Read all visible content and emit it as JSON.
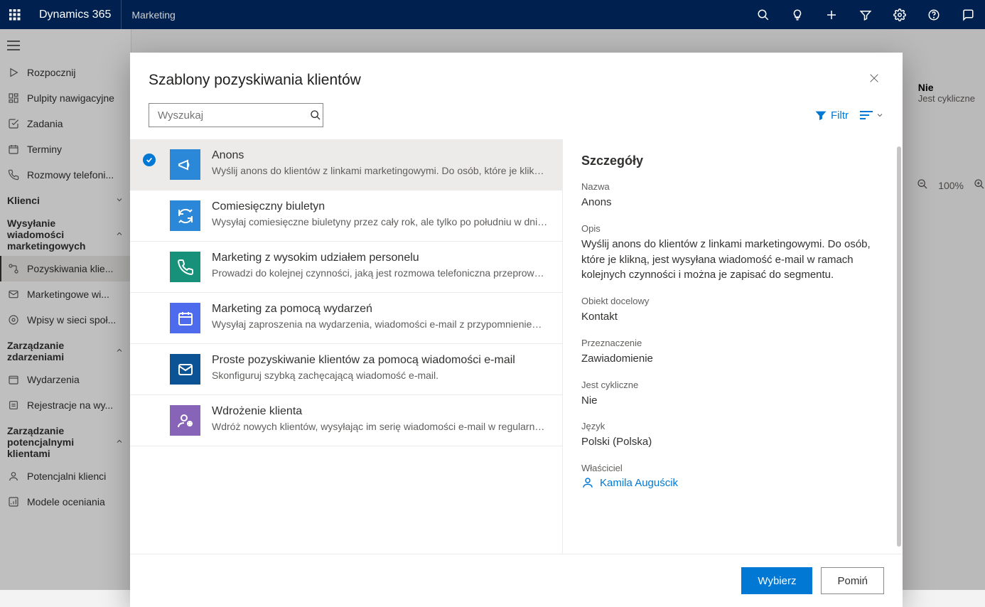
{
  "topbar": {
    "brand": "Dynamics 365",
    "area": "Marketing"
  },
  "nav": {
    "items_top": [
      {
        "label": "Rozpocznij",
        "icon": "play"
      },
      {
        "label": "Pulpity nawigacyjne",
        "icon": "dashboard"
      },
      {
        "label": "Zadania",
        "icon": "task"
      },
      {
        "label": "Terminy",
        "icon": "calendar"
      },
      {
        "label": "Rozmowy telefoni...",
        "icon": "phone"
      }
    ],
    "group_klienci": "Klienci",
    "group_marketing": "Wysyłanie wiadomości marketingowych",
    "marketing_items": [
      {
        "label": "Pozyskiwania klie...",
        "icon": "journey",
        "active": true
      },
      {
        "label": "Marketingowe wi...",
        "icon": "mail"
      },
      {
        "label": "Wpisy w sieci społ...",
        "icon": "social"
      }
    ],
    "group_events": "Zarządzanie zdarzeniami",
    "events_items": [
      {
        "label": "Wydarzenia",
        "icon": "event"
      },
      {
        "label": "Rejestracje na wy...",
        "icon": "register"
      }
    ],
    "group_leads": "Zarządzanie potencjalnymi klientami",
    "leads_items": [
      {
        "label": "Potencjalni klienci",
        "icon": "lead"
      },
      {
        "label": "Modele oceniania",
        "icon": "score"
      }
    ]
  },
  "behind": {
    "chip_label": "Nie",
    "chip_sub": "Jest cykliczne",
    "zoom": "100%"
  },
  "modal": {
    "title": "Szablony pozyskiwania klientów",
    "search_placeholder": "Wyszukaj",
    "filter_label": "Filtr",
    "templates": [
      {
        "title": "Anons",
        "desc": "Wyślij anons do klientów z linkami marketingowymi. Do osób, które je klikną, jest ...",
        "color": "#2b88d8",
        "icon": "megaphone",
        "selected": true
      },
      {
        "title": "Comiesięczny biuletyn",
        "desc": "Wysyłaj comiesięczne biuletyny przez cały rok, ale tylko po południu w dni powsze...",
        "color": "#2b88d8",
        "icon": "refresh"
      },
      {
        "title": "Marketing z wysokim udziałem personelu",
        "desc": "Prowadzi do kolejnej czynności, jaką jest rozmowa telefoniczna przeprowadzana pr...",
        "color": "#17917a",
        "icon": "phone"
      },
      {
        "title": "Marketing za pomocą wydarzeń",
        "desc": "Wysyłaj zaproszenia na wydarzenia, wiadomości e-mail z przypomnieniem, a na ko...",
        "color": "#4f6bed",
        "icon": "calendar"
      },
      {
        "title": "Proste pozyskiwanie klientów za pomocą wiadomości e-mail",
        "desc": "Skonfiguruj szybką zachęcającą wiadomość e-mail.",
        "color": "#0b5394",
        "icon": "mail"
      },
      {
        "title": "Wdrożenie klienta",
        "desc": "Wdróż nowych klientów, wysyłając im serię wiadomości e-mail w regularnych odst...",
        "color": "#8764b8",
        "icon": "person"
      }
    ],
    "details": {
      "heading": "Szczegóły",
      "name_label": "Nazwa",
      "name_value": "Anons",
      "desc_label": "Opis",
      "desc_value": "Wyślij anons do klientów z linkami marketingowymi. Do osób, które je klikną, jest wysyłana wiadomość e-mail w ramach kolejnych czynności i można je zapisać do segmentu.",
      "target_label": "Obiekt docelowy",
      "target_value": "Kontakt",
      "purpose_label": "Przeznaczenie",
      "purpose_value": "Zawiadomienie",
      "recurring_label": "Jest cykliczne",
      "recurring_value": "Nie",
      "lang_label": "Język",
      "lang_value": "Polski (Polska)",
      "owner_label": "Właściciel",
      "owner_value": "Kamila Auguścik"
    },
    "footer": {
      "select": "Wybierz",
      "skip": "Pomiń"
    }
  }
}
